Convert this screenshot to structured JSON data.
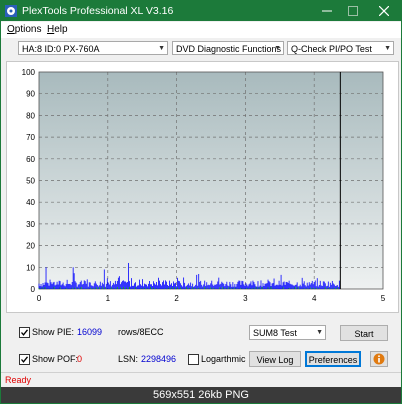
{
  "window": {
    "title": "PlexTools Professional XL V3.16",
    "buttons": {
      "minimize": "—",
      "maximize": "☐",
      "close": "✕"
    }
  },
  "menu": [
    {
      "label": "Options",
      "underline": "O",
      "rest": "ptions"
    },
    {
      "label": "Help",
      "underline": "H",
      "rest": "elp"
    }
  ],
  "combos": {
    "drive": "HA:8 ID:0  PX-760A",
    "function": "DVD Diagnostic Functions",
    "test": "Q-Check PI/PO Test"
  },
  "chart_data": {
    "type": "bar",
    "ylim": [
      0,
      100
    ],
    "xlim": [
      0,
      5
    ],
    "yticks": [
      "100",
      "90",
      "80",
      "70",
      "60",
      "50",
      "40",
      "30",
      "20",
      "10",
      "0"
    ],
    "xticks": [
      "0",
      "1",
      "2",
      "3",
      "4",
      "5"
    ],
    "end_marker_x": 4.38,
    "series": [
      {
        "type": "bar",
        "color": "#0000ff",
        "x_range": [
          0,
          4.38
        ],
        "typical_range": [
          1,
          4
        ],
        "peak_values": [
          {
            "x": 1.3,
            "y": 12
          },
          {
            "x": 0.5,
            "y": 10
          },
          {
            "x": 0.95,
            "y": 9
          },
          {
            "x": 0.1,
            "y": 10
          }
        ]
      },
      {
        "type": "bar",
        "color": "#00b000",
        "x_range": [
          0,
          4.38
        ],
        "typical_range": [
          0,
          1
        ]
      }
    ],
    "colors": {
      "background_top": "#a8babd",
      "background_bottom": "#eef1f1",
      "grid": "#707070",
      "pie_bars": "#0000ff",
      "pif_bars": "#00b000"
    }
  },
  "controls": {
    "show_pie_label": "Show PIE:",
    "show_pie_value": "16099",
    "show_pie_checked": true,
    "rows_label": "rows/8ECC",
    "show_pof_label": "Show POF:",
    "show_pof_value": "0",
    "show_pof_checked": true,
    "lsn_label": "LSN:",
    "lsn_value": "2298496",
    "logarithmic_label": "Logarthmic",
    "logarithmic_checked": false,
    "sum_test": "SUM8 Test",
    "start_label": "Start",
    "view_log_label": "View Log",
    "preferences_label": "Preferences",
    "info_icon_color": "#e07a10"
  },
  "status": "Ready",
  "caption": "569x551  26kb  PNG"
}
